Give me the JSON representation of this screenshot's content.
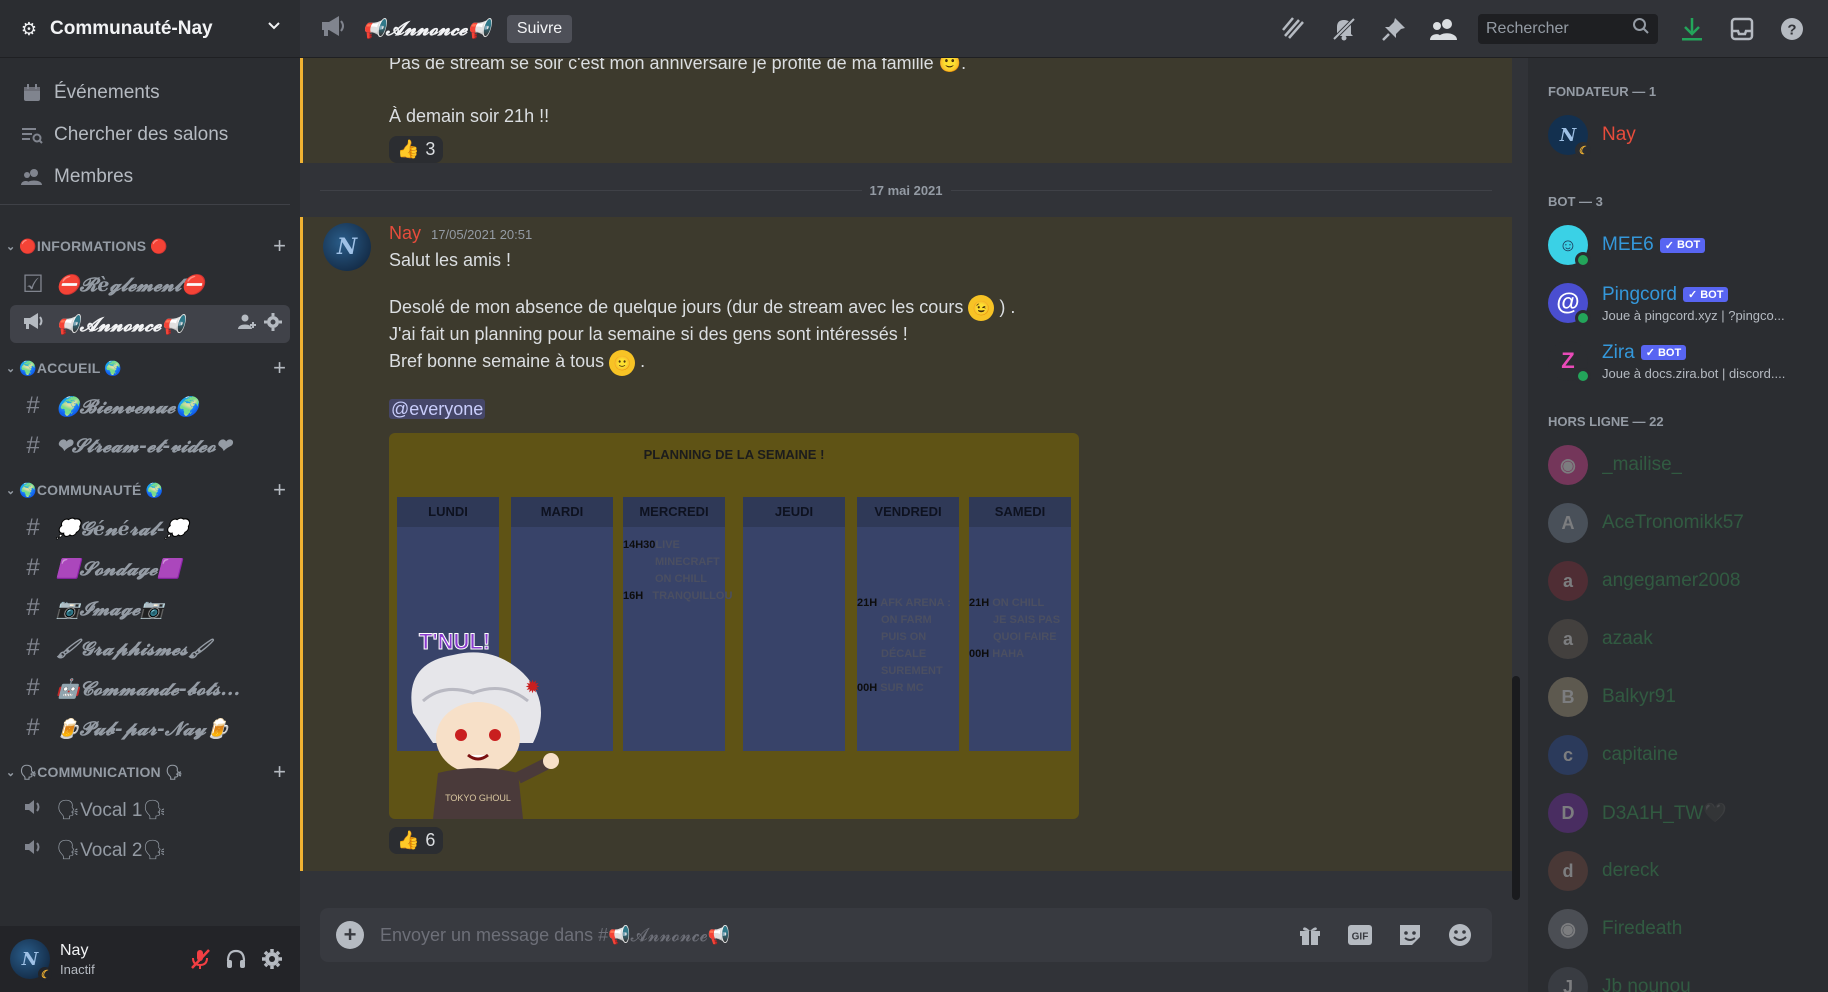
{
  "server": {
    "name": "Communauté-Nay",
    "nav": [
      {
        "label": "Événements",
        "icon": "calendar-icon"
      },
      {
        "label": "Chercher des salons",
        "icon": "browse-channels-icon"
      },
      {
        "label": "Membres",
        "icon": "members-icon"
      }
    ]
  },
  "categories": [
    {
      "label": "🔴INFORMATIONS 🔴",
      "channels": [
        {
          "name": "⛔𝓡è𝓰𝓵𝓮𝓶𝓮𝓷𝓽⛔",
          "icon": "rules-icon",
          "type": "text"
        },
        {
          "name": "📢𝓐𝓷𝓷𝓸𝓷𝓬𝓮📢",
          "icon": "announcement-icon",
          "type": "text",
          "active": true
        }
      ]
    },
    {
      "label": "🌍ACCUEIL 🌍",
      "channels": [
        {
          "name": "🌍𝓑𝓲𝓮𝓷𝓿𝓮𝓷𝓾𝓮🌍",
          "icon": "hash-icon",
          "type": "text"
        },
        {
          "name": "❤𝓢𝓽𝓻𝓮𝓪𝓶-𝓮𝓽-𝓿𝓲𝓭𝓮𝓸❤",
          "icon": "hash-icon",
          "type": "text"
        }
      ]
    },
    {
      "label": "🌍COMMUNAUTÉ 🌍",
      "channels": [
        {
          "name": "💭𝓖é𝓷é𝓻𝓪𝓵-💭",
          "icon": "hash-icon",
          "type": "text"
        },
        {
          "name": "🟪𝓢𝓸𝓷𝓭𝓪𝓰𝓮🟪",
          "icon": "hash-icon",
          "type": "text"
        },
        {
          "name": "📷𝓘𝓶𝓪𝓰𝓮📷",
          "icon": "hash-icon",
          "type": "text"
        },
        {
          "name": "🖌𝓖𝓻𝓪𝓹𝓱𝓲𝓼𝓶𝓮𝓼🖌",
          "icon": "hash-icon",
          "type": "text"
        },
        {
          "name": "🤖𝓒𝓸𝓶𝓶𝓪𝓷𝓭𝓮-𝓫𝓸𝓽𝓼...",
          "icon": "hash-icon",
          "type": "text"
        },
        {
          "name": "🍺𝓟𝓾𝓫-𝓹𝓪𝓻-𝓝𝓪𝔂🍺",
          "icon": "hash-icon",
          "type": "text"
        }
      ]
    },
    {
      "label": "🗣COMMUNICATION 🗣",
      "channels": [
        {
          "name": "🗣Vocal 1🗣",
          "icon": "speaker-icon",
          "type": "voice"
        },
        {
          "name": "🗣Vocal 2🗣",
          "icon": "speaker-icon",
          "type": "voice"
        }
      ]
    }
  ],
  "user": {
    "name": "Nay",
    "status": "Inactif",
    "avatar_letter": "N"
  },
  "topbar": {
    "channel_title": "📢𝓐𝓷𝓷𝓸𝓷𝓬𝓮📢",
    "follow_label": "Suivre",
    "search_placeholder": "Rechercher"
  },
  "messages": {
    "first": {
      "lines": [
        "Pas de stream se soir c'est mon anniversaire je profite de ma famille 🙂.",
        "À demain soir 21h !!"
      ],
      "reaction": {
        "emoji": "👍",
        "count": "3"
      }
    },
    "date_divider": "17 mai 2021",
    "second": {
      "author": "Nay",
      "avatar_letter": "N",
      "timestamp": "17/05/2021 20:51",
      "line1": "Salut les amis !",
      "line2a": "Desolé de mon absence de quelque jours (dur de stream avec les cours",
      "line2b": ") .",
      "line3": "J'ai fait un planning pour la semaine si des gens sont intéressés !",
      "line4a": "Bref bonne semaine à tous",
      "line4b": ".",
      "mention": "@everyone",
      "reaction": {
        "emoji": "👍",
        "count": "6"
      }
    },
    "planning": {
      "title": "PLANNING DE LA SEMAINE !",
      "days": [
        "LUNDI",
        "MARDI",
        "MERCREDI",
        "JEUDI",
        "VENDREDI",
        "SAMEDI"
      ],
      "mercredi": [
        {
          "time": "14H30",
          "activity": "LIVE"
        },
        {
          "time": "",
          "activity": "MINECRAFT"
        },
        {
          "time": "",
          "activity": "ON CHILL"
        },
        {
          "time": "16H",
          "activity": "TRANQUILLOU"
        }
      ],
      "vendredi": [
        {
          "time": "21H",
          "activity": "AFK ARENA :"
        },
        {
          "time": "",
          "activity": "ON FARM"
        },
        {
          "time": "",
          "activity": "PUIS ON"
        },
        {
          "time": "",
          "activity": "DÉCALE"
        },
        {
          "time": "",
          "activity": "SUREMENT"
        },
        {
          "time": "00H",
          "activity": "SUR MC"
        }
      ],
      "samedi": [
        {
          "time": "21H",
          "activity": "ON CHILL"
        },
        {
          "time": "",
          "activity": "JE SAIS PAS"
        },
        {
          "time": "",
          "activity": "QUOI FAIRE"
        },
        {
          "time": "00H",
          "activity": "HAHA"
        }
      ],
      "sticker_text": "T'NUL!",
      "sticker_shirt": "TOKYO GHOUL"
    }
  },
  "composer": {
    "placeholder": "Envoyer un message dans #📢𝓐𝓷𝓷𝓸𝓷𝓬𝓮📢"
  },
  "members": {
    "groups": [
      {
        "label": "FONDATEUR — 1",
        "items": [
          {
            "name": "Nay",
            "color": "#e74c3c",
            "avatar_letter": "N",
            "avatar_bg": "#13304f",
            "status": "idle"
          }
        ]
      },
      {
        "label": "BOT — 3",
        "items": [
          {
            "name": "MEE6",
            "color": "#3498db",
            "bot_label": "BOT",
            "avatar_letter": "☺",
            "avatar_bg": "#3ad1e6",
            "status": "online"
          },
          {
            "name": "Pingcord",
            "color": "#3498db",
            "bot_label": "BOT",
            "activity": "Joue à pingcord.xyz | ?pingco...",
            "avatar_letter": "@",
            "avatar_bg": "#4a4ed0",
            "status": "online"
          },
          {
            "name": "Zira",
            "color": "#3498db",
            "bot_label": "BOT",
            "activity": "Joue à docs.zira.bot | discord....",
            "avatar_letter": "Z",
            "avatar_bg": "#2b2d31",
            "status": "online"
          }
        ]
      },
      {
        "label": "HORS LIGNE — 22",
        "items": [
          {
            "name": "_mailise_",
            "avatar_bg": "#eb459e",
            "avatar_letter": "◉"
          },
          {
            "name": "AceTronomikk57",
            "avatar_bg": "#7a8a9a",
            "avatar_letter": "A"
          },
          {
            "name": "angegamer2008",
            "avatar_bg": "#8a2f3a",
            "avatar_letter": "a"
          },
          {
            "name": "azaak",
            "avatar_bg": "#6b6055",
            "avatar_letter": "a"
          },
          {
            "name": "Balkyr91",
            "avatar_bg": "#b0a080",
            "avatar_letter": "B"
          },
          {
            "name": "capitaine",
            "avatar_bg": "#2c4fa0",
            "avatar_letter": "c"
          },
          {
            "name": "D3A1H_TW🖤",
            "avatar_bg": "#7a2fb0",
            "avatar_letter": "D"
          },
          {
            "name": "dereck",
            "avatar_bg": "#7a4a40",
            "avatar_letter": "d"
          },
          {
            "name": "Firedeath",
            "avatar_bg": "#80848e",
            "avatar_letter": "◉"
          },
          {
            "name": "Jb nounou",
            "avatar_bg": "#505560",
            "avatar_letter": "J"
          }
        ]
      }
    ]
  },
  "colors": {
    "accent": "#5865f2",
    "highlight_border": "#f0b232",
    "author_red": "#e74c3c",
    "bot_blue": "#3498db",
    "download_green": "#23a55a"
  }
}
